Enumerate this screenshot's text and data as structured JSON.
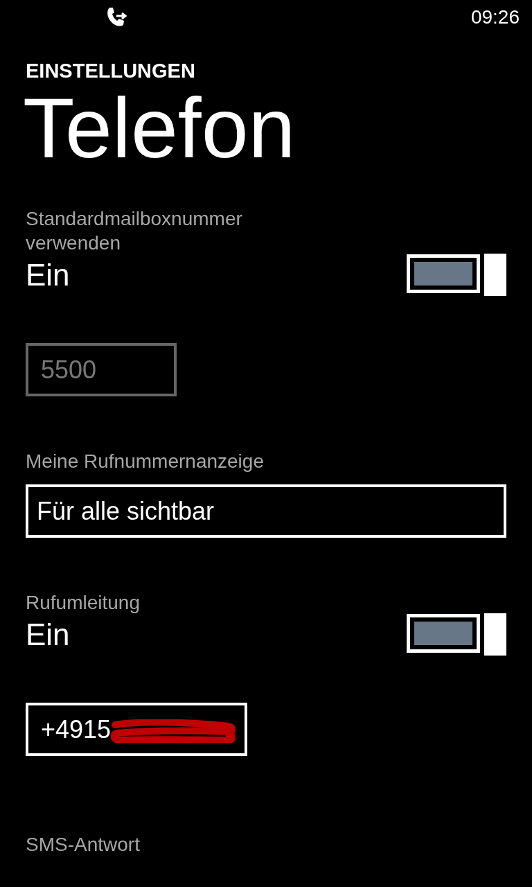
{
  "status_bar": {
    "time": "09:26",
    "call_forwarding": true
  },
  "header": {
    "section": "EINSTELLUNGEN",
    "title": "Telefon"
  },
  "settings": [
    {
      "kind": "toggle",
      "label": "Standardmailboxnummer verwenden",
      "state_text": "Ein",
      "on": true
    },
    {
      "kind": "field",
      "value": "5500",
      "disabled": true,
      "redacted": false
    },
    {
      "kind": "picker",
      "label": "Meine Rufnummernanzeige",
      "value": "Für alle sichtbar"
    },
    {
      "kind": "toggle",
      "label": "Rufumleitung",
      "state_text": "Ein",
      "on": true
    },
    {
      "kind": "field",
      "value": "+4915",
      "disabled": false,
      "redacted": true
    },
    {
      "kind": "heading",
      "label": "SMS-Antwort"
    }
  ]
}
